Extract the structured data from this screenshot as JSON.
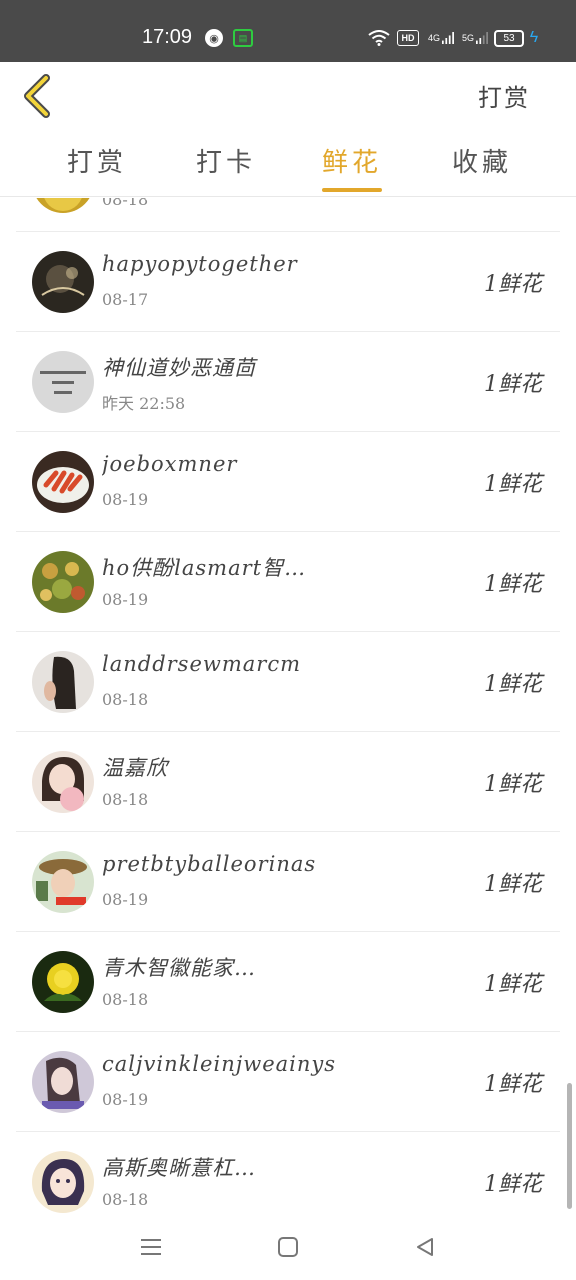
{
  "status_bar": {
    "time": "17:09",
    "hd_label": "HD",
    "net1": "4G",
    "net2": "5G",
    "battery": "53"
  },
  "header": {
    "right_label": "打赏"
  },
  "tabs": [
    {
      "label": "打赏",
      "active": false
    },
    {
      "label": "打卡",
      "active": false
    },
    {
      "label": "鲜花",
      "active": true
    },
    {
      "label": "收藏",
      "active": false
    }
  ],
  "colors": {
    "accent": "#e2a72b",
    "status_bar": "#4a4a4a"
  },
  "rows": [
    {
      "name": "",
      "date": "08-18",
      "amount": "",
      "avatar": "food-yellow"
    },
    {
      "name": "hapyopytogether",
      "date": "08-17",
      "amount": "1鲜花",
      "avatar": "dark-photo"
    },
    {
      "name": "神仙道妙恶通茴",
      "date": "昨天 22:58",
      "amount": "1鲜花",
      "avatar": "grey-text"
    },
    {
      "name": "joeboxmner",
      "date": "08-19",
      "amount": "1鲜花",
      "avatar": "food-red"
    },
    {
      "name": "ho供酚lasmart智…",
      "date": "08-19",
      "amount": "1鲜花",
      "avatar": "food-green"
    },
    {
      "name": "landdrsewmarcm",
      "date": "08-18",
      "amount": "1鲜花",
      "avatar": "girl-hair"
    },
    {
      "name": "温嘉欣",
      "date": "08-18",
      "amount": "1鲜花",
      "avatar": "girl-doll"
    },
    {
      "name": "pretbtyballeorinas",
      "date": "08-19",
      "amount": "1鲜花",
      "avatar": "girl-hat"
    },
    {
      "name": "青木智徽能家…",
      "date": "08-18",
      "amount": "1鲜花",
      "avatar": "yellow-rose"
    },
    {
      "name": "caljvinkleinjweainys",
      "date": "08-19",
      "amount": "1鲜花",
      "avatar": "girl-purple"
    },
    {
      "name": "高斯奥晰薏杠…",
      "date": "08-18",
      "amount": "1鲜花",
      "avatar": "anime-girl"
    }
  ]
}
